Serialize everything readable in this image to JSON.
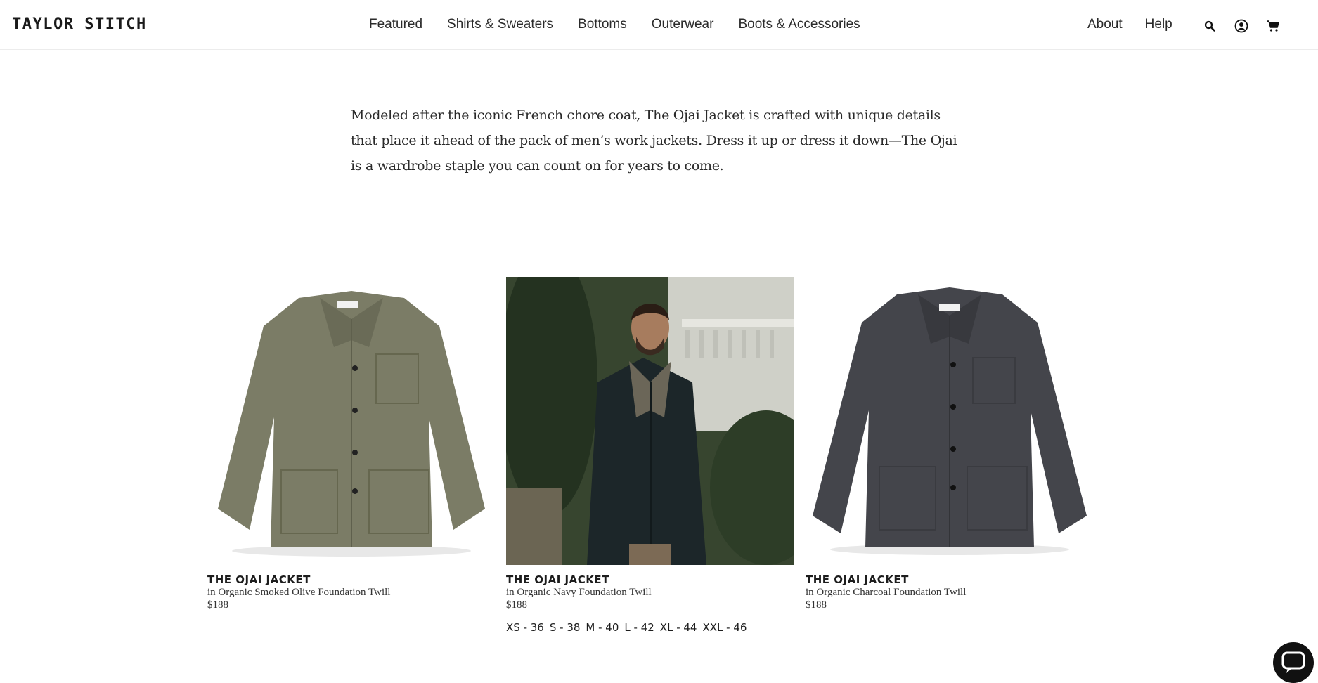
{
  "brand": {
    "logo": "TAYLOR STITCH"
  },
  "nav": {
    "items": [
      "Featured",
      "Shirts & Sweaters",
      "Bottoms",
      "Outerwear",
      "Boots & Accessories"
    ]
  },
  "utility": {
    "about": "About",
    "help": "Help"
  },
  "icons": {
    "search": "search-icon",
    "account": "account-icon",
    "cart": "cart-icon",
    "chat": "chat-icon"
  },
  "intro": {
    "text": "Modeled after the iconic French chore coat, The Ojai Jacket is crafted with unique details that place it ahead of the pack of men’s work jackets. Dress it up or dress it down—The Ojai is a wardrobe staple you can count on for years to come."
  },
  "products": [
    {
      "title": "THE OJAI JACKET",
      "subtitle": "in Organic Smoked Olive Foundation Twill",
      "price": "$188",
      "color": "#7a7a64"
    },
    {
      "title": "THE OJAI JACKET",
      "subtitle": "in Organic Navy Foundation Twill",
      "price": "$188",
      "color": "#1f2a2e",
      "sizes": [
        "XS - 36",
        "S - 38",
        "M - 40",
        "L - 42",
        "XL - 44",
        "XXL - 46"
      ]
    },
    {
      "title": "THE OJAI JACKET",
      "subtitle": "in Organic Charcoal Foundation Twill",
      "price": "$188",
      "color": "#45464c"
    }
  ]
}
